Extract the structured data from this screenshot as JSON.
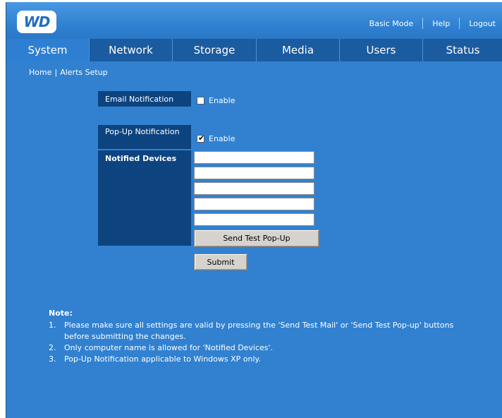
{
  "header": {
    "logo_text": "WD",
    "links": [
      "Basic Mode",
      "Help",
      "Logout"
    ]
  },
  "nav": {
    "tabs": [
      "System",
      "Network",
      "Storage",
      "Media",
      "Users",
      "Status"
    ],
    "active": "System"
  },
  "breadcrumb": {
    "home": "Home",
    "separator": "|",
    "current": "Alerts Setup"
  },
  "form": {
    "email_label": "Email Notification",
    "email_enable_label": "Enable",
    "email_checked": false,
    "popup_label": "Pop-Up Notification",
    "popup_enable_label": "Enable",
    "popup_checked": true,
    "devices_label": "Notified Devices",
    "devices": [
      "",
      "",
      "",
      "",
      ""
    ],
    "send_test_label": "Send Test Pop-Up",
    "submit_label": "Submit"
  },
  "note": {
    "title": "Note:",
    "items": [
      {
        "num": "1.",
        "text": "Please make sure all settings are valid by pressing the 'Send Test Mail' or 'Send Test Pop-up' buttons before submitting the changes."
      },
      {
        "num": "2.",
        "text": "Only computer name is allowed for 'Notified Devices'."
      },
      {
        "num": "3.",
        "text": "Pop-Up Notification applicable to Windows XP only."
      }
    ]
  },
  "colors": {
    "background": "#3181d0",
    "nav_bar": "#1b5b9f",
    "label_bg": "#0d4480"
  }
}
